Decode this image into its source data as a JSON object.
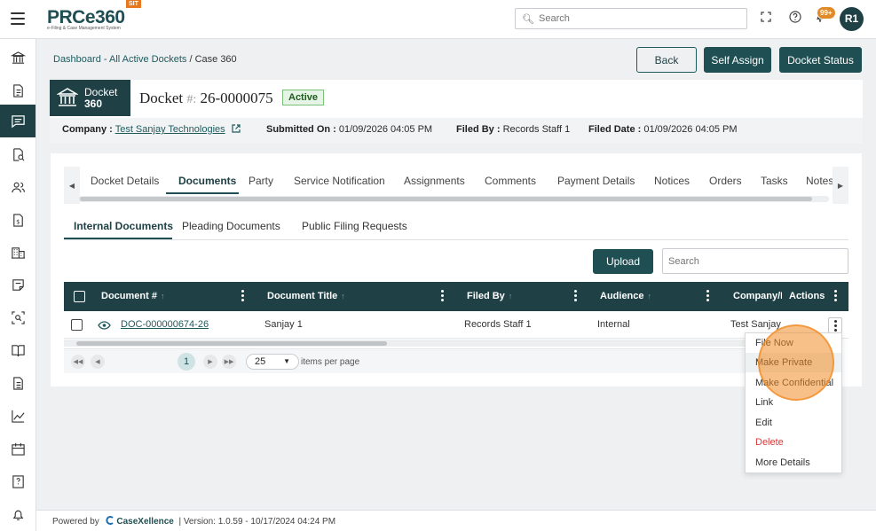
{
  "app": {
    "logo_text": "PRCe360",
    "logo_tagline": "e-Filing & Case Management System",
    "env_badge": "SIT",
    "notif_count": "99+",
    "avatar_initials": "R1",
    "search_placeholder": "Search"
  },
  "breadcrumb": {
    "link": "Dashboard - All Active Dockets",
    "separator": " / ",
    "current": "Case 360"
  },
  "actions": {
    "back": "Back",
    "self_assign": "Self Assign",
    "docket_status": "Docket Status"
  },
  "docket": {
    "badge_line1": "Docket",
    "badge_line2": "360",
    "title_prefix": "Docket",
    "hash": "#:",
    "number": "26-0000075",
    "status": "Active",
    "company_label": "Company :",
    "company_value": "Test Sanjay Technologies",
    "submitted_label": "Submitted On :",
    "submitted_value": "01/09/2026 04:05 PM",
    "filed_by_label": "Filed By :",
    "filed_by_value": "Records Staff 1",
    "filed_date_label": "Filed Date :",
    "filed_date_value": "01/09/2026 04:05 PM"
  },
  "tabs": [
    "Docket Details",
    "Documents",
    "Party",
    "Service Notification",
    "Assignments",
    "Comments",
    "Payment Details",
    "Notices",
    "Orders",
    "Tasks",
    "Notes"
  ],
  "subtabs": [
    "Internal Documents",
    "Pleading Documents",
    "Public Filing Requests"
  ],
  "toolbar": {
    "upload": "Upload",
    "search_placeholder": "Search"
  },
  "grid": {
    "columns": [
      "Document #",
      "Document Title",
      "Filed By",
      "Audience",
      "Company/I",
      "Actions"
    ],
    "rows": [
      {
        "doc_no": "DOC-000000674-26",
        "title": "Sanjay 1",
        "filed_by": "Records Staff 1",
        "audience": "Internal",
        "company": "Test Sanjay"
      }
    ],
    "page": "1",
    "page_size": "25",
    "items_per_page": "items per page"
  },
  "row_menu": [
    "File Now",
    "Make Private",
    "Make Confidential",
    "Link",
    "Edit",
    "Delete",
    "More Details"
  ],
  "footer": {
    "powered_by": "Powered by",
    "brand": "CaseXellence",
    "version": "|  Version: 1.0.59 - 10/17/2024 04:24 PM"
  },
  "colors": {
    "primary": "#1f4146",
    "accent": "#e8781f",
    "danger": "#d83a3a",
    "active_badge_bg": "#e6f4e6"
  }
}
